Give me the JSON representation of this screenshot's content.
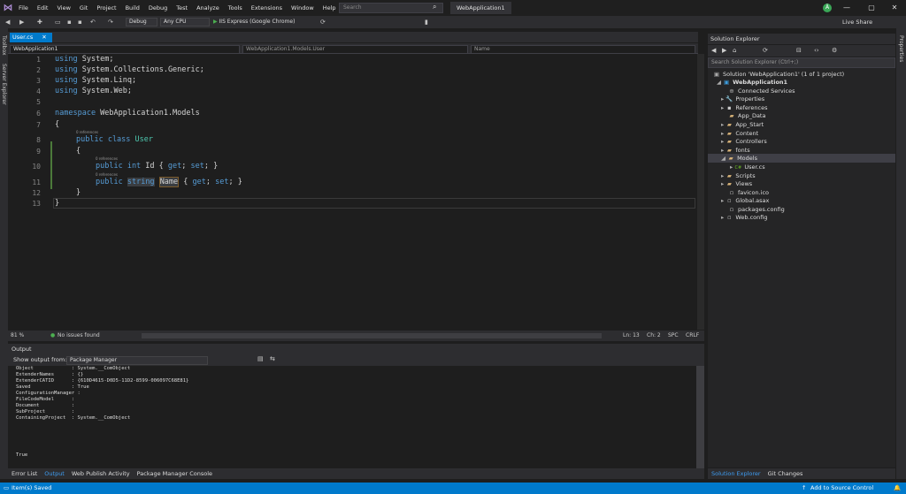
{
  "menu": [
    "File",
    "Edit",
    "View",
    "Git",
    "Project",
    "Build",
    "Debug",
    "Test",
    "Analyze",
    "Tools",
    "Extensions",
    "Window",
    "Help"
  ],
  "search": {
    "placeholder": "Search"
  },
  "solution_name": "WebApplication1",
  "avatar_initial": "Ä",
  "liveshare": "Live Share",
  "toolbar": {
    "config": "Debug",
    "platform": "Any CPU",
    "run": "IIS Express (Google Chrome)"
  },
  "left_tabs": [
    "Toolbox",
    "Server Explorer"
  ],
  "right_tab": "Properties",
  "doc_tab": "User.cs",
  "nav": {
    "project": "WebApplication1",
    "class": "WebApplication1.Models.User",
    "member": "Name"
  },
  "code": {
    "lines": [
      "1",
      "2",
      "3",
      "4",
      "5",
      "6",
      "7",
      "8",
      "9",
      "10",
      "11",
      "12",
      "13"
    ],
    "l1a": "using",
    "l1b": " System;",
    "l2a": "using",
    "l2b": " System.Collections.Generic;",
    "l3a": "using",
    "l3b": " System.Linq;",
    "l4a": "using",
    "l4b": " System.Web;",
    "l6a": "namespace",
    "l6b": " WebApplication1.Models",
    "l7": "{",
    "l8a": "public class",
    "l8b": " User",
    "l9": "{",
    "l10a": "public int",
    "l10b": " Id { ",
    "l10c": "get",
    "l10d": "; ",
    "l10e": "set",
    "l10f": "; }",
    "l11a": "public",
    "l11b": "string",
    "l11c": "Name",
    "l11d": " { ",
    "l11e": "get",
    "l11f": "; ",
    "l11g": "set",
    "l11h": "; }",
    "l12": "}",
    "l13": "}",
    "refs": "0 references"
  },
  "editor_status": {
    "zoom": "81 %",
    "issues": "No issues found",
    "ln": "Ln: 13",
    "ch": "Ch: 2",
    "spc": "SPC",
    "crlf": "CRLF"
  },
  "output": {
    "title": "Output",
    "show_label": "Show output from:",
    "source": "Package Manager",
    "text": "Object             : System.__ComObject\nExtenderNames      : {}\nExtenderCATID      : {610D4615-D0D5-11D2-8599-006097C68E81}\nSaved              : True\nConfigurationManager :\nFileCodeModel      :\nDocument           :\nSubProject         :\nContainingProject  : System.__ComObject\n\n\n\n\n\nTrue"
  },
  "bottom_tabs": [
    "Error List",
    "Output",
    "Web Publish Activity",
    "Package Manager Console"
  ],
  "solution_explorer": {
    "title": "Solution Explorer",
    "search_placeholder": "Search Solution Explorer (Ctrl+;)",
    "items": [
      {
        "label": "Solution 'WebApplication1' (1 of 1 project)",
        "icon": "solution-icon"
      },
      {
        "label": "WebApplication1",
        "icon": "project-icon"
      },
      {
        "label": "Connected Services",
        "icon": "connected-services-icon"
      },
      {
        "label": "Properties",
        "icon": "wrench-icon"
      },
      {
        "label": "References",
        "icon": "references-icon"
      },
      {
        "label": "App_Data",
        "icon": "folder-icon"
      },
      {
        "label": "App_Start",
        "icon": "folder-icon"
      },
      {
        "label": "Content",
        "icon": "folder-icon"
      },
      {
        "label": "Controllers",
        "icon": "folder-icon"
      },
      {
        "label": "fonts",
        "icon": "folder-icon"
      },
      {
        "label": "Models",
        "icon": "folder-icon"
      },
      {
        "label": "User.cs",
        "icon": "csharp-file-icon"
      },
      {
        "label": "Scripts",
        "icon": "folder-icon"
      },
      {
        "label": "Views",
        "icon": "folder-icon"
      },
      {
        "label": "favicon.ico",
        "icon": "file-icon"
      },
      {
        "label": "Global.asax",
        "icon": "file-icon"
      },
      {
        "label": "packages.config",
        "icon": "file-icon"
      },
      {
        "label": "Web.config",
        "icon": "file-icon"
      }
    ],
    "tabs": [
      "Solution Explorer",
      "Git Changes"
    ]
  },
  "status": {
    "saved": "Item(s) Saved",
    "source_control": "Add to Source Control"
  },
  "colors": {
    "accent": "#007acc",
    "keyword": "#569cd6",
    "type": "#4ec9b0"
  }
}
